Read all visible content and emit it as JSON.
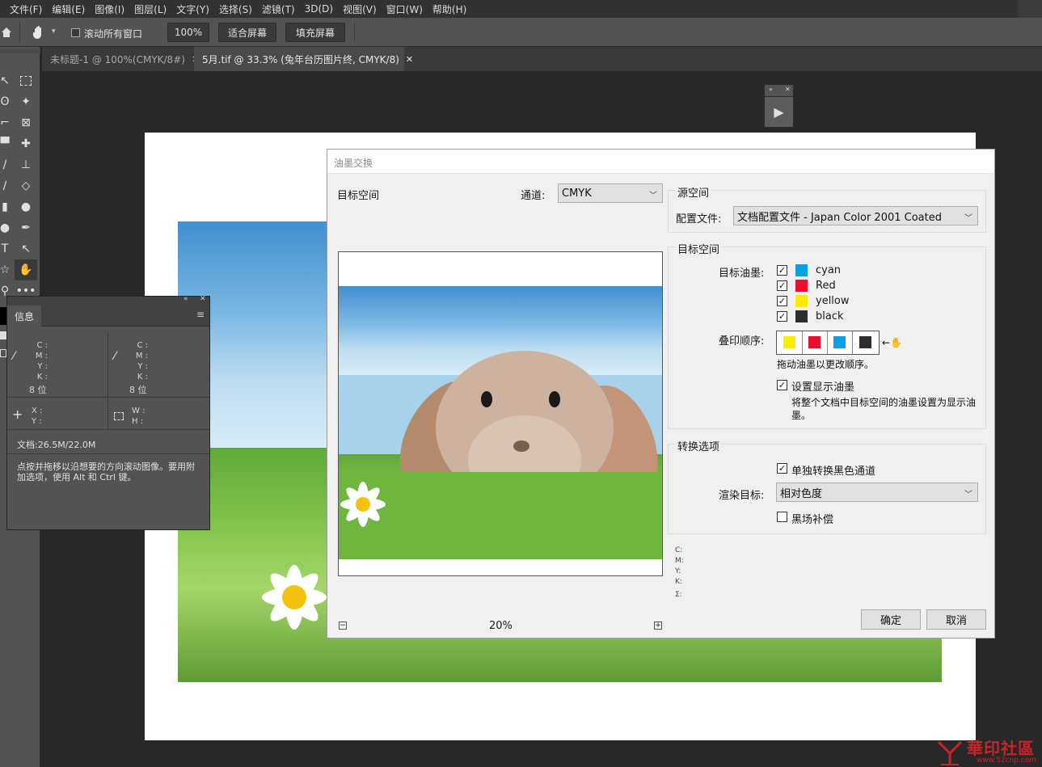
{
  "menu": {
    "items": [
      "文件(F)",
      "编辑(E)",
      "图像(I)",
      "图层(L)",
      "文字(Y)",
      "选择(S)",
      "滤镜(T)",
      "3D(D)",
      "视图(V)",
      "窗口(W)",
      "帮助(H)"
    ]
  },
  "options_bar": {
    "scroll_all_label": "滚动所有窗口",
    "zoom_value": "100%",
    "fit_screen": "适合屏幕",
    "fill_screen": "填充屏幕"
  },
  "tabs": [
    {
      "label": "未标题-1 @ 100%(CMYK/8#)",
      "active": false
    },
    {
      "label": "5月.tif @ 33.3% (兔年台历图片终, CMYK/8)",
      "active": true
    }
  ],
  "info_panel": {
    "title": "信息",
    "cmyk_labels": [
      "C :",
      "M :",
      "Y :",
      "K :"
    ],
    "bit_depth": "8 位",
    "xy_labels": [
      "X :",
      "Y :"
    ],
    "wh_labels": [
      "W :",
      "H :"
    ],
    "doc_size": "文档:26.5M/22.0M",
    "hint": "点按并拖移以沿想要的方向滚动图像。要用附加选项，使用 Alt 和 Ctrl 键。"
  },
  "dialog": {
    "title": "油墨交换",
    "target_space_label": "目标空间",
    "channel_label": "通道:",
    "channel_value": "CMYK",
    "zoom_value": "20%",
    "source_group_title": "源空间",
    "profile_label": "配置文件:",
    "profile_value": "文档配置文件 - Japan Color 2001 Coated",
    "target_group_title": "目标空间",
    "target_ink_label": "目标油墨:",
    "inks": [
      {
        "name": "cyan",
        "color": "#0a9fe0",
        "checked": true
      },
      {
        "name": "Red",
        "color": "#e8102e",
        "checked": true
      },
      {
        "name": "yellow",
        "color": "#ffec00",
        "checked": true
      },
      {
        "name": "black",
        "color": "#2d2d2d",
        "checked": true
      }
    ],
    "overprint_label": "叠印顺序:",
    "overprint_order": [
      "#ffec00",
      "#e8102e",
      "#0a9fe0",
      "#2d2d2d"
    ],
    "drag_hint": "拖动油墨以更改顺序。",
    "set_display_label": "设置显示油墨",
    "set_display_desc": "将整个文档中目标空间的油墨设置为显示油墨。",
    "convert_group_title": "转换选项",
    "separate_black_label": "单独转换黑色通道",
    "render_label": "渲染目标:",
    "render_value": "相对色度",
    "black_comp_label": "黑场补偿",
    "readout_labels": [
      "C:",
      "M:",
      "Y:",
      "K:",
      "Σ:"
    ],
    "ok_label": "确定",
    "cancel_label": "取消"
  },
  "watermark": {
    "text": "華印社區",
    "url": "www.52cnp.com"
  }
}
